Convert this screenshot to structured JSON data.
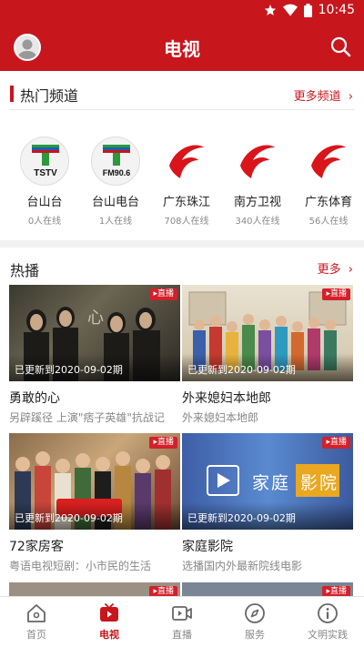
{
  "status_bar": {
    "time": "10:45"
  },
  "header": {
    "title": "电视"
  },
  "hot_channels": {
    "title": "热门频道",
    "more_label": "更多频道",
    "items": [
      {
        "name": "台山台",
        "online": "0人在线",
        "logo": "TSTV",
        "icon": "tstv-logo"
      },
      {
        "name": "台山电台",
        "online": "1人在线",
        "logo": "FM90.6",
        "icon": "tstv-logo"
      },
      {
        "name": "广东珠江",
        "online": "708人在线",
        "icon": "gdtv-logo"
      },
      {
        "name": "南方卫视",
        "online": "340人在线",
        "icon": "gdtv-logo"
      },
      {
        "name": "广东体育",
        "online": "56人在线",
        "icon": "gdtv-logo"
      }
    ]
  },
  "hot_play": {
    "title": "热播",
    "more_label": "更多",
    "badge_label": "直播",
    "items": [
      {
        "title": "勇敢的心",
        "subtitle": "另辟蹊径 上演\"痞子英雄\"抗战记",
        "update": "已更新到2020-09-02期"
      },
      {
        "title": "外来媳妇本地郎",
        "subtitle": "外来媳妇本地郎",
        "update": "已更新到2020-09-02期"
      },
      {
        "title": "72家房客",
        "subtitle": "粤语电视短剧：小市民的生活",
        "update": "已更新到2020-09-02期"
      },
      {
        "title": "家庭影院",
        "subtitle": "选播国内外最新院线电影",
        "update": "已更新到2020-09-02期",
        "thumb_text_1": "家庭",
        "thumb_text_2": "影院"
      }
    ]
  },
  "tabs": [
    {
      "label": "首页",
      "icon": "home-icon",
      "active": false
    },
    {
      "label": "电视",
      "icon": "tv-icon",
      "active": true
    },
    {
      "label": "直播",
      "icon": "live-video-icon",
      "active": false
    },
    {
      "label": "服务",
      "icon": "compass-icon",
      "active": false
    },
    {
      "label": "文明实践",
      "icon": "info-icon",
      "active": false
    }
  ],
  "colors": {
    "brand": "#c8161d",
    "text": "#222222",
    "muted": "#888888"
  }
}
